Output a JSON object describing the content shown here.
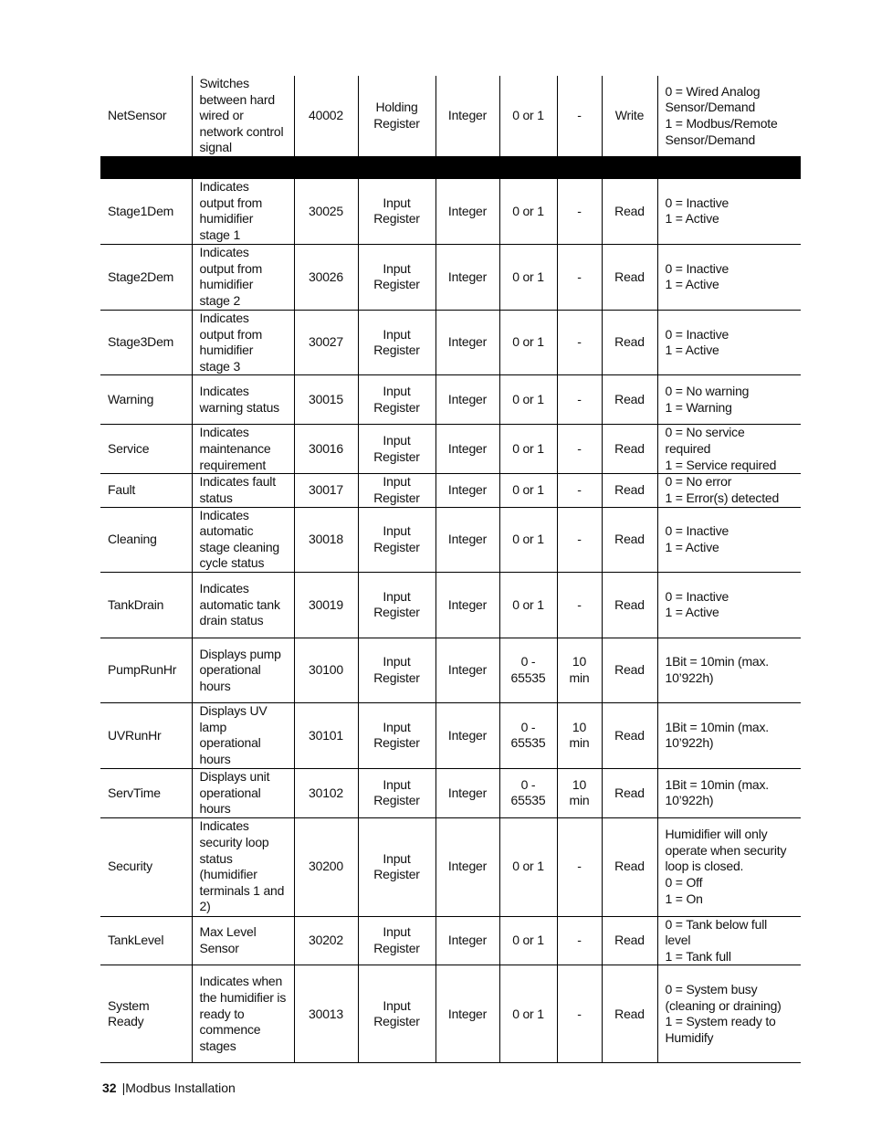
{
  "rows": [
    {
      "name": "NetSensor",
      "description": "Switches between hard wired or network control signal",
      "address": "40002",
      "register_type": "Holding Register",
      "data_type": "Integer",
      "range": "0 or 1",
      "units": "-",
      "access": "Write",
      "notes": "0 = Wired Analog Sensor/Demand\n1 = Modbus/Remote Sensor/Demand"
    },
    {
      "name": "Stage1Dem",
      "description": "Indicates output from humidifier stage 1",
      "address": "30025",
      "register_type": "Input Register",
      "data_type": "Integer",
      "range": "0 or 1",
      "units": "-",
      "access": "Read",
      "notes": "0 = Inactive\n1 = Active"
    },
    {
      "name": "Stage2Dem",
      "description": "Indicates output from humidifier stage 2",
      "address": "30026",
      "register_type": "Input Register",
      "data_type": "Integer",
      "range": "0 or 1",
      "units": "-",
      "access": "Read",
      "notes": "0 = Inactive\n1 = Active"
    },
    {
      "name": "Stage3Dem",
      "description": "Indicates output from humidifier stage 3",
      "address": "30027",
      "register_type": "Input Register",
      "data_type": "Integer",
      "range": "0 or 1",
      "units": "-",
      "access": "Read",
      "notes": "0 = Inactive\n1 = Active"
    },
    {
      "name": "Warning",
      "description": "Indicates warning status",
      "address": "30015",
      "register_type": "Input Register",
      "data_type": "Integer",
      "range": "0 or 1",
      "units": "-",
      "access": "Read",
      "notes": "0 = No warning\n1 = Warning"
    },
    {
      "name": "Service",
      "description": "Indicates maintenance requirement",
      "address": "30016",
      "register_type": "Input Register",
      "data_type": "Integer",
      "range": "0 or 1",
      "units": "-",
      "access": "Read",
      "notes": "0 = No service required\n1 = Service required"
    },
    {
      "name": "Fault",
      "description": "Indicates fault status",
      "address": "30017",
      "register_type": "Input Register",
      "data_type": "Integer",
      "range": "0 or 1",
      "units": "-",
      "access": "Read",
      "notes": "0 = No error\n1 = Error(s) detected"
    },
    {
      "name": "Cleaning",
      "description": "Indicates automatic stage cleaning cycle status",
      "address": "30018",
      "register_type": "Input Register",
      "data_type": "Integer",
      "range": "0 or 1",
      "units": "-",
      "access": "Read",
      "notes": "0 = Inactive\n1 = Active"
    },
    {
      "name": "TankDrain",
      "description": "Indicates automatic tank drain status",
      "address": "30019",
      "register_type": "Input Register",
      "data_type": "Integer",
      "range": "0 or 1",
      "units": "-",
      "access": "Read",
      "notes": "0 = Inactive\n1 = Active"
    },
    {
      "name": "PumpRunHr",
      "description": "Displays pump operational hours",
      "address": "30100",
      "register_type": "Input Register",
      "data_type": "Integer",
      "range": "0 - 65535",
      "units": "10 min",
      "access": "Read",
      "notes": "1Bit = 10min  (max. 10’922h)"
    },
    {
      "name": "UVRunHr",
      "description": "Displays UV lamp operational hours",
      "address": "30101",
      "register_type": "Input Register",
      "data_type": "Integer",
      "range": "0 - 65535",
      "units": "10 min",
      "access": "Read",
      "notes": "1Bit = 10min  (max. 10’922h)"
    },
    {
      "name": "ServTime",
      "description": "Displays unit operational hours",
      "address": "30102",
      "register_type": "Input Register",
      "data_type": "Integer",
      "range": "0 - 65535",
      "units": "10 min",
      "access": "Read",
      "notes": "1Bit = 10min  (max. 10’922h)"
    },
    {
      "name": "Security",
      "description": "Indicates security loop status (humidifier terminals 1 and 2)",
      "address": "30200",
      "register_type": "Input Register",
      "data_type": "Integer",
      "range": "0 or 1",
      "units": "-",
      "access": "Read",
      "notes": "Humidifier will only operate when security loop is closed.\n0 = Off\n1 = On"
    },
    {
      "name": "TankLevel",
      "description": "Max Level Sensor",
      "address": "30202",
      "register_type": "Input Register",
      "data_type": "Integer",
      "range": "0 or 1",
      "units": "-",
      "access": "Read",
      "notes": "0 = Tank below full level\n1 = Tank full"
    },
    {
      "name": "System Ready",
      "description": "Indicates when the humidifier is ready to commence stages",
      "address": "30013",
      "register_type": "Input Register",
      "data_type": "Integer",
      "range": "0 or 1",
      "units": "-",
      "access": "Read",
      "notes": "0 = System busy (cleaning or draining)\n1 = System ready to Humidify"
    }
  ],
  "footer": {
    "page_number": "32",
    "section": "|Modbus Installation"
  }
}
